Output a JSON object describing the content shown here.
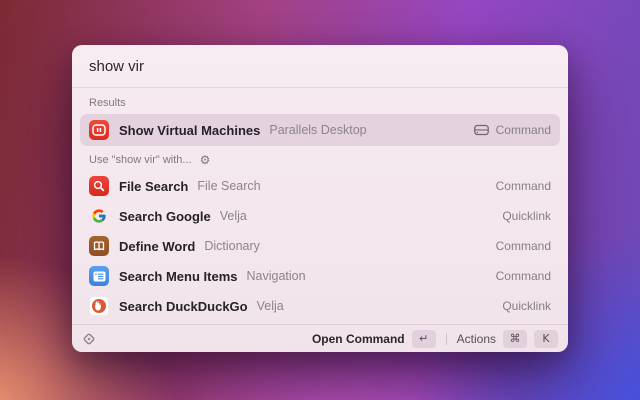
{
  "search": {
    "value": "show vir"
  },
  "sections": {
    "results_header": "Results",
    "suggestions_header": "Use \"show vir\" with..."
  },
  "rows": [
    {
      "icon": "parallels-icon",
      "title": "Show Virtual Machines",
      "subtitle": "Parallels Desktop",
      "type": "Command",
      "selected": true,
      "accessory_icon": "hard-drive-icon"
    },
    {
      "icon": "file-search-icon",
      "title": "File Search",
      "subtitle": "File Search",
      "type": "Command"
    },
    {
      "icon": "google-icon",
      "title": "Search Google",
      "subtitle": "Velja",
      "type": "Quicklink"
    },
    {
      "icon": "dictionary-icon",
      "title": "Define Word",
      "subtitle": "Dictionary",
      "type": "Command"
    },
    {
      "icon": "menu-items-icon",
      "title": "Search Menu Items",
      "subtitle": "Navigation",
      "type": "Command"
    },
    {
      "icon": "duckduckgo-icon",
      "title": "Search DuckDuckGo",
      "subtitle": "Velja",
      "type": "Quicklink"
    }
  ],
  "footer": {
    "primary_label": "Open Command",
    "primary_key": "↵",
    "actions_label": "Actions",
    "action_keys": [
      "⌘",
      "K"
    ]
  },
  "icons": {
    "gear": "⚙"
  },
  "colors": {
    "window_bg": "#f4e7ee",
    "selection": "#e4d3df",
    "parallels_red": "#e0342b",
    "tag_text": "#877e86",
    "bg_maroon": "#7d2a34",
    "bg_magenta": "#a44284",
    "bg_purple": "#9747c5",
    "bg_blue": "#4053e8",
    "bg_salmon": "#f49a76"
  }
}
